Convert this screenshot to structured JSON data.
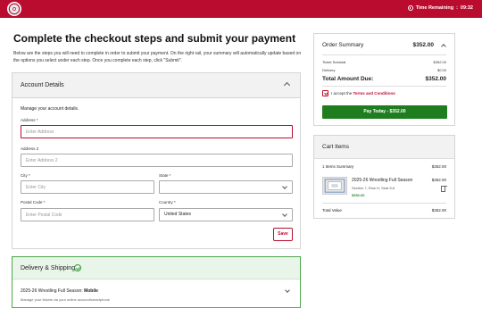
{
  "header": {
    "logo_icon": "ohio-state-logo",
    "timer_label": "Time Remaining",
    "timer_value": "09:32",
    "timer_icon": "clock-icon",
    "brand_color": "#ba0c2f"
  },
  "page": {
    "title": "Complete the checkout steps and submit your payment",
    "intro": "Below are the steps you will need to complete in order to submit your payment. On the right rail, your summary will automatically update based on the options you select under each step. Once you complete each step, click \"Submit\"."
  },
  "account": {
    "title": "Account Details",
    "manage": "Manage your account details.",
    "address_label": "Address *",
    "address_placeholder": "Enter Address",
    "address2_label": "Address 2",
    "address2_placeholder": "Enter Address 2",
    "city_label": "City *",
    "city_placeholder": "Enter City",
    "state_label": "State *",
    "state_value": "",
    "postal_label": "Postal Code *",
    "postal_placeholder": "Enter Postal Code",
    "country_label": "Country *",
    "country_value": "United States",
    "save_label": "Save"
  },
  "delivery": {
    "title": "Delivery & Shipping",
    "item_prefix": "2025-26 Wrestling Full Season:",
    "item_method": "Mobile",
    "item_sub": "Manage your tickets via your online account/smartphone",
    "accent": "#4ca64c"
  },
  "summary": {
    "title": "Order Summary",
    "total_top": "$352.00",
    "ticket_subtotal_label": "Ticket Subtotal",
    "ticket_subtotal_value": "$352.00",
    "delivery_label": "Delivery",
    "delivery_value": "$0.00",
    "total_due_label": "Total Amount Due:",
    "total_due_value": "$352.00",
    "terms_prefix": "I accept the",
    "terms_link": "Terms and Conditions",
    "terms_checked": true,
    "pay_label": "Pay Today - $352.00",
    "pay_color": "#1e7d1e"
  },
  "cart": {
    "title": "Cart Items",
    "items_summary_label": "1 Items Summary",
    "items_summary_value": "$352.00",
    "item_name": "2025-26 Wrestling Full Season",
    "item_seat": "Section 7, Row H, Seat 5-6",
    "item_price": "$352.00",
    "item_amount": "$352.00",
    "total_label": "Total Value",
    "total_value": "$352.00"
  }
}
